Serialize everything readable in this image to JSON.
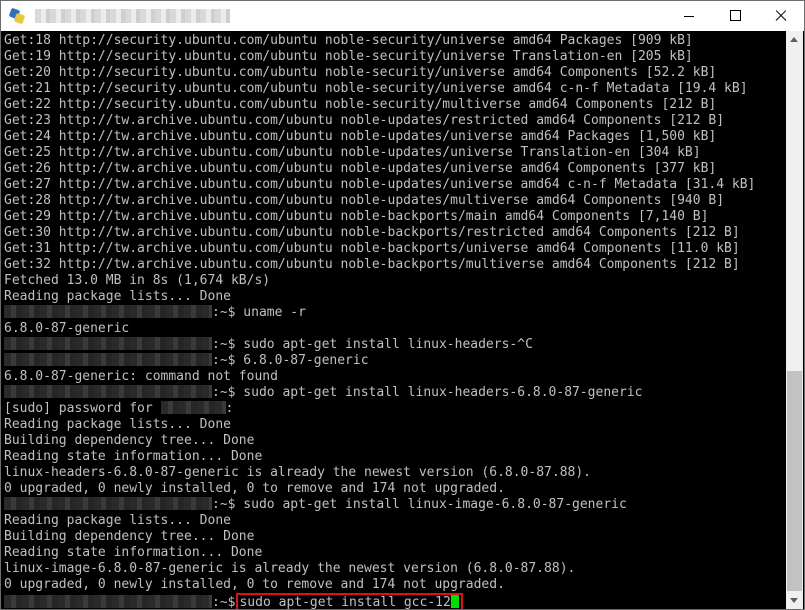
{
  "lines": [
    "Get:18 http://security.ubuntu.com/ubuntu noble-security/universe amd64 Packages [909 kB]",
    "Get:19 http://security.ubuntu.com/ubuntu noble-security/universe Translation-en [205 kB]",
    "Get:20 http://security.ubuntu.com/ubuntu noble-security/universe amd64 Components [52.2 kB]",
    "Get:21 http://security.ubuntu.com/ubuntu noble-security/universe amd64 c-n-f Metadata [19.4 kB]",
    "Get:22 http://security.ubuntu.com/ubuntu noble-security/multiverse amd64 Components [212 B]",
    "Get:23 http://tw.archive.ubuntu.com/ubuntu noble-updates/restricted amd64 Components [212 B]",
    "Get:24 http://tw.archive.ubuntu.com/ubuntu noble-updates/universe amd64 Packages [1,500 kB]",
    "Get:25 http://tw.archive.ubuntu.com/ubuntu noble-updates/universe Translation-en [304 kB]",
    "Get:26 http://tw.archive.ubuntu.com/ubuntu noble-updates/universe amd64 Components [377 kB]",
    "Get:27 http://tw.archive.ubuntu.com/ubuntu noble-updates/universe amd64 c-n-f Metadata [31.4 kB]",
    "Get:28 http://tw.archive.ubuntu.com/ubuntu noble-updates/multiverse amd64 Components [940 B]",
    "Get:29 http://tw.archive.ubuntu.com/ubuntu noble-backports/main amd64 Components [7,140 B]",
    "Get:30 http://tw.archive.ubuntu.com/ubuntu noble-backports/restricted amd64 Components [212 B]",
    "Get:31 http://tw.archive.ubuntu.com/ubuntu noble-backports/universe amd64 Components [11.0 kB]",
    "Get:32 http://tw.archive.ubuntu.com/ubuntu noble-backports/multiverse amd64 Components [212 B]",
    "Fetched 13.0 MB in 8s (1,674 kB/s)",
    "Reading package lists... Done",
    ":~$ uname -r",
    "6.8.0-87-generic",
    ":~$ sudo apt-get install linux-headers-^C",
    ":~$ 6.8.0-87-generic",
    "6.8.0-87-generic: command not found",
    ":~$ sudo apt-get install linux-headers-6.8.0-87-generic",
    "[sudo] password for ",
    ":",
    "Reading package lists... Done",
    "Building dependency tree... Done",
    "Reading state information... Done",
    "linux-headers-6.8.0-87-generic is already the newest version (6.8.0-87.88).",
    "0 upgraded, 0 newly installed, 0 to remove and 174 not upgraded.",
    ":~$ sudo apt-get install linux-image-6.8.0-87-generic",
    "Reading package lists... Done",
    "Building dependency tree... Done",
    "Reading state information... Done",
    "linux-image-6.8.0-87-generic is already the newest version (6.8.0-87.88).",
    "0 upgraded, 0 newly installed, 0 to remove and 174 not upgraded.",
    ":~$",
    "sudo apt-get install gcc-12"
  ],
  "colors": {
    "terminal_bg": "#000000",
    "terminal_text": "#c0c0c0",
    "highlight_box": "#e01010",
    "cursor": "#00e000"
  },
  "icons": {
    "app": "putty-icon",
    "minimize": "minimize-icon",
    "maximize": "maximize-icon",
    "close": "close-icon"
  }
}
